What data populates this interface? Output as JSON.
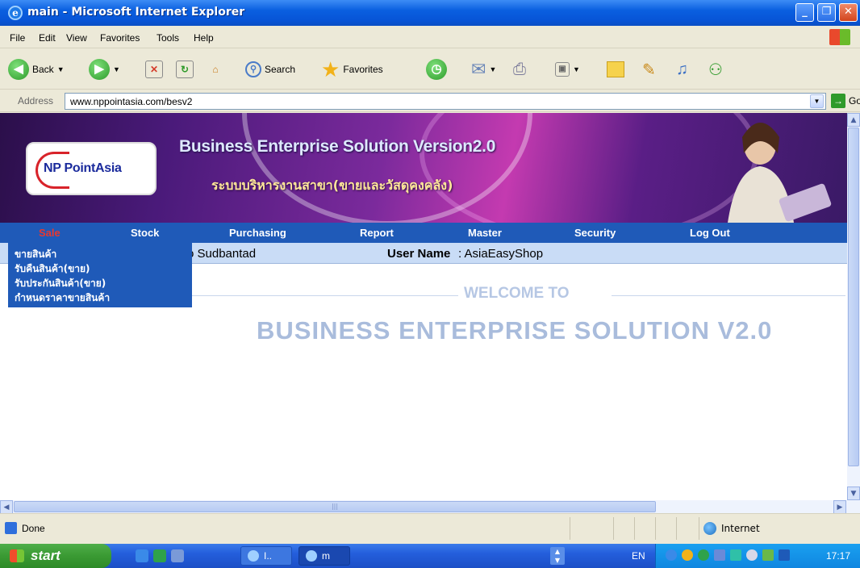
{
  "window": {
    "title": "main - Microsoft Internet Explorer"
  },
  "menu": {
    "items": [
      "File",
      "Edit",
      "View",
      "Favorites",
      "Tools",
      "Help"
    ]
  },
  "toolbar": {
    "back": "Back",
    "search": "Search",
    "favorites": "Favorites"
  },
  "address": {
    "label": "Address",
    "url": "www.nppointasia.com/besv2",
    "go": "Go"
  },
  "banner": {
    "logo_text": "NP PointAsia",
    "title": "Business Enterprise Solution Version2.0",
    "subtitle": "ระบบบริหารงานสาขา(ขายและวัสดุคงคลัง)"
  },
  "nav": {
    "items": [
      "Sale",
      "Stock",
      "Purchasing",
      "Report",
      "Master",
      "Security",
      "Log Out"
    ],
    "active": "Sale"
  },
  "info": {
    "branch": "o Sudbantad",
    "user_label": "User Name",
    "user_value": ": AsiaEasyShop"
  },
  "sale_menu": {
    "items": [
      "ขายสินค้า",
      "รับคืนสินค้า(ขาย)",
      "รับประกันสินค้า(ขาย)",
      "กำหนดราคาขายสินค้า"
    ]
  },
  "welcome": {
    "line1": "WELCOME TO",
    "line2": "BUSINESS ENTERPRISE SOLUTION V2.0"
  },
  "status": {
    "text": "Done",
    "zone": "Internet"
  },
  "taskbar": {
    "start": "start",
    "tasks": [
      "I..",
      "m"
    ],
    "lang": "EN",
    "clock": "17:17"
  },
  "colors": {
    "nav_bg": "#1f5ab8",
    "active_nav": "#e8382f",
    "info_bg": "#c9dcf6",
    "welcome_text": "#a9bcdc"
  }
}
